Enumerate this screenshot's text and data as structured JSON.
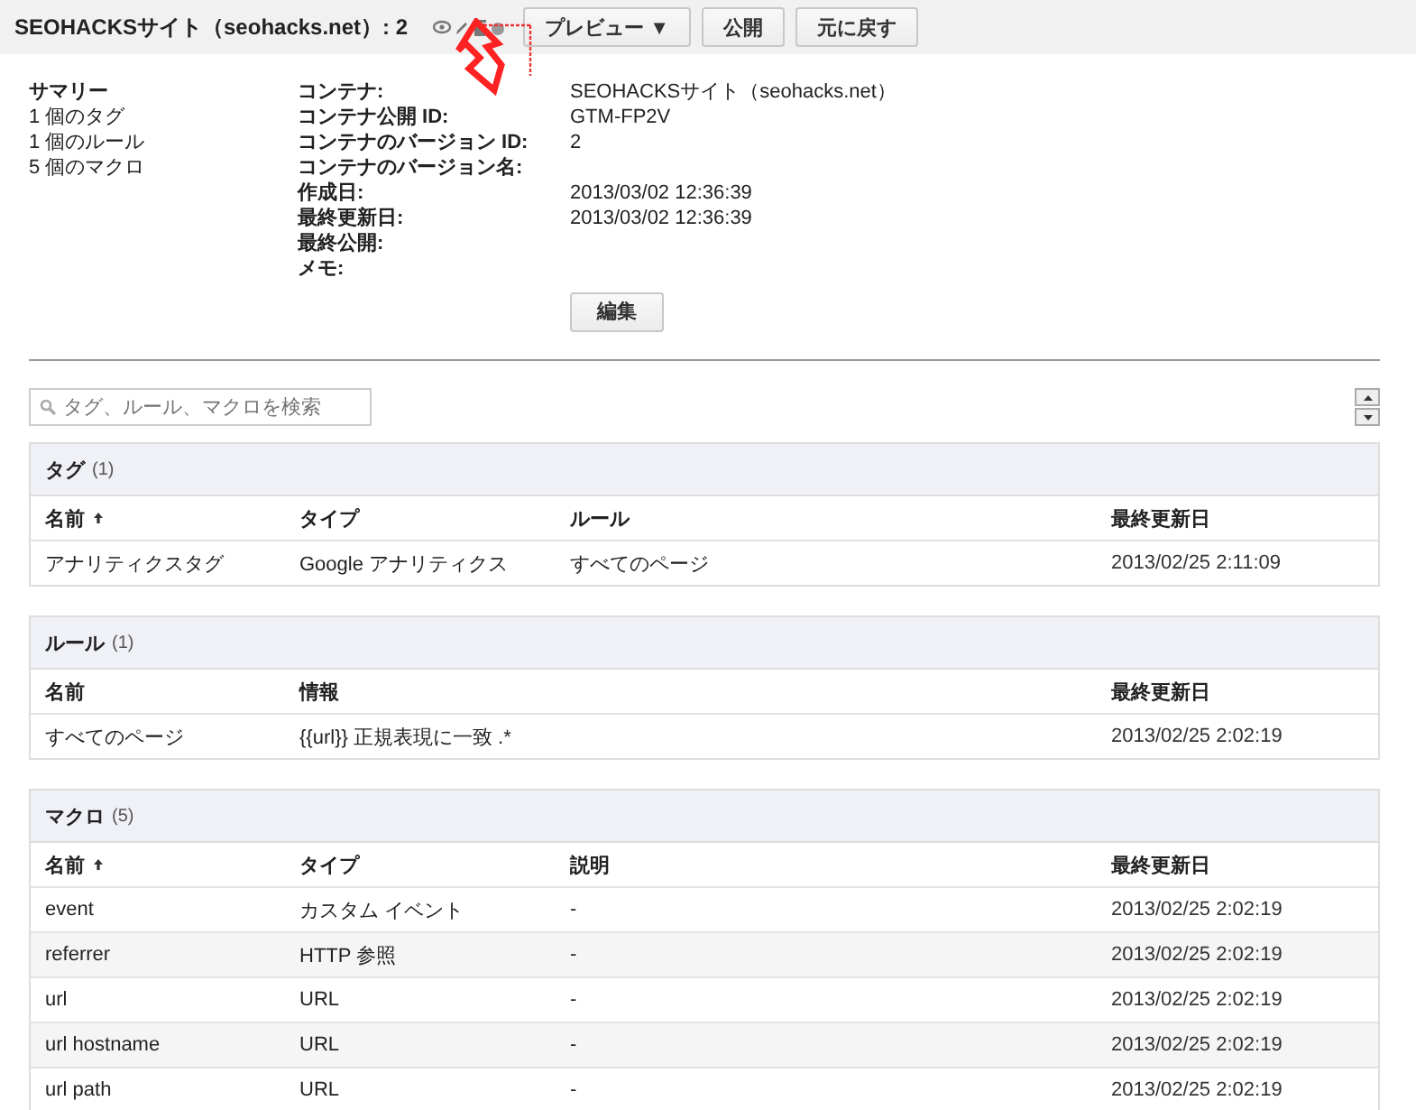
{
  "header": {
    "title": "SEOHACKSサイト（seohacks.net）: 2",
    "buttons": [
      {
        "label": "プレビュー ▼"
      },
      {
        "label": "公開"
      },
      {
        "label": "元に戻す"
      }
    ]
  },
  "summary": {
    "title": "サマリー",
    "lines": [
      "1 個のタグ",
      "1 個のルール",
      "5 個のマクロ"
    ]
  },
  "details": [
    {
      "label": "コンテナ:",
      "value": "SEOHACKSサイト（seohacks.net）"
    },
    {
      "label": "コンテナ公開 ID:",
      "value": "GTM-FP2V"
    },
    {
      "label": "コンテナのバージョン ID:",
      "value": "2"
    },
    {
      "label": "コンテナのバージョン名:"
    },
    {
      "label": "作成日:",
      "value": "2013/03/02 12:36:39"
    },
    {
      "label": "最終更新日:",
      "value": "2013/03/02 12:36:39"
    },
    {
      "label": "最終公開:"
    },
    {
      "label": "メモ:"
    }
  ],
  "edit_button": "編集",
  "search": {
    "placeholder": "タグ、ルール、マクロを検索"
  },
  "sections": [
    {
      "title": "タグ",
      "count": "(1)",
      "columns": [
        {
          "label": "名前",
          "sorted": true
        },
        {
          "label": "タイプ",
          "sorted": false
        },
        {
          "label": "ルール",
          "sorted": false
        },
        {
          "label": "最終更新日",
          "sorted": false
        }
      ],
      "rows": [
        [
          "アナリティクスタグ",
          "Google アナリティクス",
          "すべてのページ",
          "2013/02/25 2:11:09"
        ]
      ]
    },
    {
      "title": "ルール",
      "count": "(1)",
      "columns": [
        {
          "label": "名前",
          "sorted": false
        },
        {
          "label": "情報",
          "sorted": false
        },
        {
          "label": "最終更新日",
          "sorted": false
        }
      ],
      "rows": [
        [
          "すべてのページ",
          "{{url}} 正規表現に一致 .*",
          "2013/02/25 2:02:19"
        ]
      ]
    },
    {
      "title": "マクロ",
      "count": "(5)",
      "columns": [
        {
          "label": "名前",
          "sorted": true
        },
        {
          "label": "タイプ",
          "sorted": false
        },
        {
          "label": "説明",
          "sorted": false
        },
        {
          "label": "最終更新日",
          "sorted": false
        }
      ],
      "rows": [
        [
          "event",
          "カスタム イベント",
          "-",
          "2013/02/25 2:02:19"
        ],
        [
          "referrer",
          "HTTP 参照",
          "-",
          "2013/02/25 2:02:19"
        ],
        [
          "url",
          "URL",
          "-",
          "2013/02/25 2:02:19"
        ],
        [
          "url hostname",
          "URL",
          "-",
          "2013/02/25 2:02:19"
        ],
        [
          "url path",
          "URL",
          "-",
          "2013/02/25 2:02:19"
        ]
      ]
    }
  ]
}
